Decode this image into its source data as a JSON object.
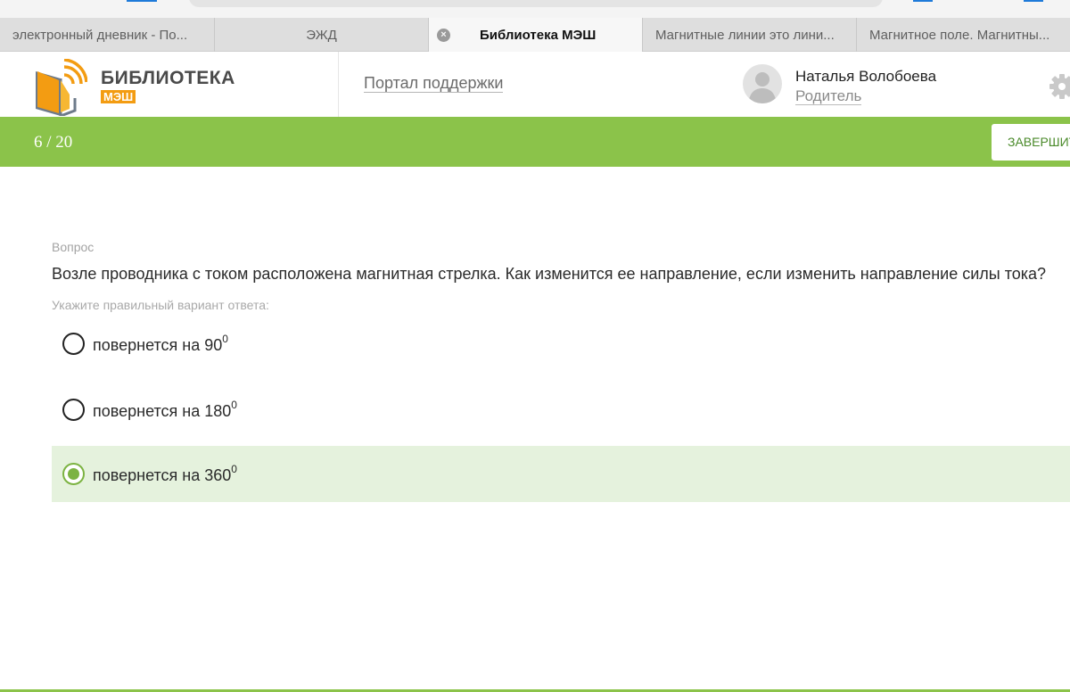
{
  "browser": {
    "tabs": [
      {
        "label": "электронный дневник - По..."
      },
      {
        "label": "ЭЖД"
      },
      {
        "label": "Библиотека МЭШ",
        "active": true
      },
      {
        "label": "Магнитные линии это лини..."
      },
      {
        "label": "Магнитное поле. Магнитны..."
      }
    ]
  },
  "header": {
    "brand_name": "БИБЛИОТЕКА",
    "brand_sub": "МЭШ",
    "support_link": "Портал поддержки",
    "user_name": "Наталья Волобоева",
    "user_role": "Родитель"
  },
  "progress": {
    "counter": "6 / 20",
    "current": 6,
    "total": 20,
    "finish_label": "ЗАВЕРШИТЬ"
  },
  "question": {
    "caption": "Вопрос",
    "text": "Возле проводника с током расположена магнитная стрелка. Как изменится ее направление, если изменить направление силы тока?",
    "hint": "Укажите правильный вариант ответа:",
    "options": [
      {
        "text": "повернется на 90",
        "sup": "0",
        "selected": false
      },
      {
        "text": "повернется на 180",
        "sup": "0",
        "selected": false
      },
      {
        "text": "повернется на 360",
        "sup": "0",
        "selected": true
      }
    ]
  },
  "colors": {
    "accent_green": "#8bc34a",
    "selected_bg": "#e5f2dd",
    "brand_orange": "#f39c12",
    "link_blue": "#1e7ad9"
  },
  "icons": {
    "tab_close": "close-circle-icon",
    "avatar": "user-avatar-icon",
    "settings": "gear-icon",
    "logo": "book-wifi-logo"
  }
}
